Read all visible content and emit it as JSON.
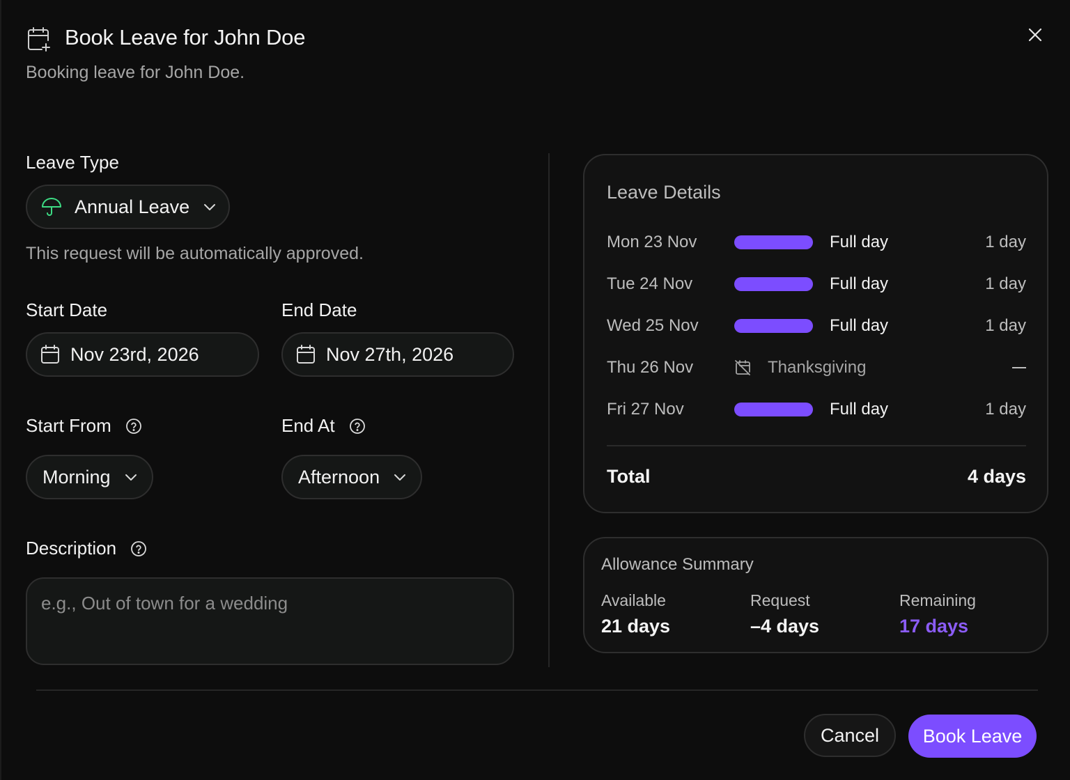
{
  "header": {
    "title": "Book Leave for John Doe",
    "subtitle": "Booking leave for John Doe.",
    "icon": "calendar-plus-icon",
    "close_icon": "close-icon"
  },
  "form": {
    "leave_type_label": "Leave Type",
    "leave_type_value": "Annual Leave",
    "leave_type_icon": "umbrella-icon",
    "approval_note": "This request will be automatically approved.",
    "start_date_label": "Start Date",
    "start_date_value": "Nov 23rd, 2026",
    "end_date_label": "End Date",
    "end_date_value": "Nov 27th, 2026",
    "start_from_label": "Start From",
    "start_from_value": "Morning",
    "end_at_label": "End At",
    "end_at_value": "Afternoon",
    "description_label": "Description",
    "description_placeholder": "e.g., Out of town for a wedding"
  },
  "leave_details": {
    "title": "Leave Details",
    "rows": [
      {
        "date": "Mon 23 Nov",
        "type": "Full day",
        "amount": "1 day"
      },
      {
        "date": "Tue 24 Nov",
        "type": "Full day",
        "amount": "1 day"
      },
      {
        "date": "Wed 25 Nov",
        "type": "Full day",
        "amount": "1 day"
      },
      {
        "date": "Thu 26 Nov",
        "type": "Thanksgiving",
        "amount": "",
        "holiday": true
      },
      {
        "date": "Fri 27 Nov",
        "type": "Full day",
        "amount": "1 day"
      }
    ],
    "total_label": "Total",
    "total_value": "4 days"
  },
  "allowance": {
    "title": "Allowance Summary",
    "available_label": "Available",
    "available_value": "21 days",
    "request_label": "Request",
    "request_value": "–4 days",
    "remaining_label": "Remaining",
    "remaining_value": "17 days"
  },
  "actions": {
    "cancel_label": "Cancel",
    "book_label": "Book Leave"
  },
  "colors": {
    "accent": "#7c4dff",
    "accent_text": "#8b5cf6",
    "umbrella": "#3ddc84",
    "background": "#0d0d0d"
  }
}
